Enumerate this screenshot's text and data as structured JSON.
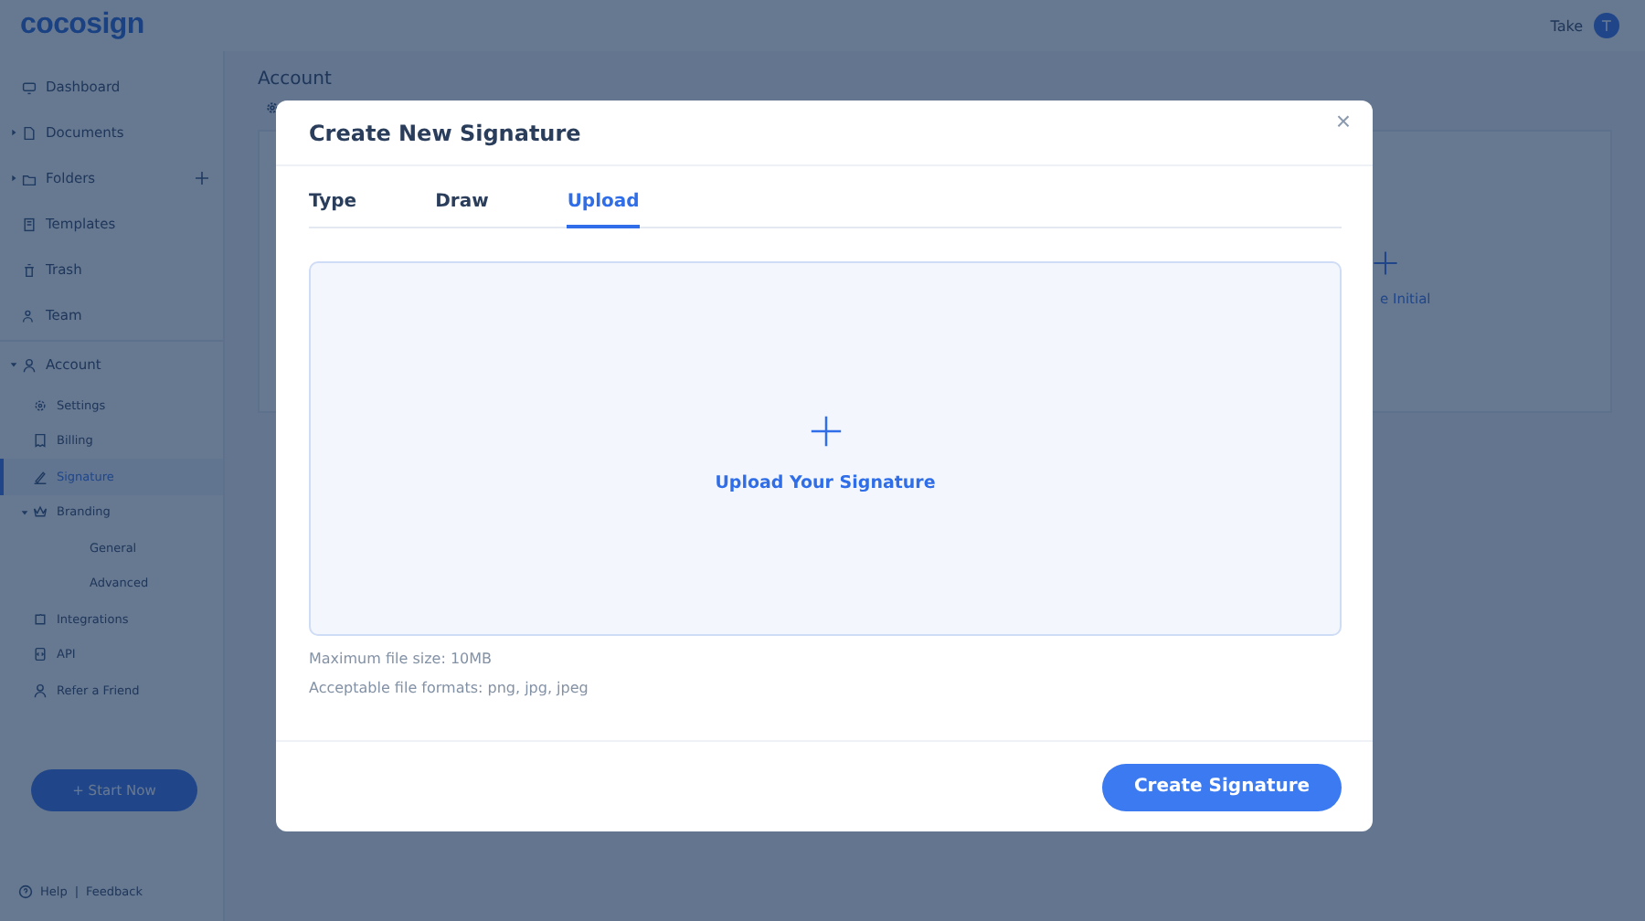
{
  "app": {
    "logo": "cocosign",
    "user": {
      "name": "Take",
      "initial": "T"
    }
  },
  "sidebar": {
    "items": [
      {
        "label": "Dashboard",
        "selected": false
      },
      {
        "label": "Documents",
        "selected": false,
        "expanded": false
      },
      {
        "label": "Folders",
        "selected": false,
        "expanded": false,
        "add_button": true
      },
      {
        "label": "Templates",
        "selected": false
      },
      {
        "label": "Trash",
        "selected": false
      },
      {
        "label": "Team",
        "selected": false
      },
      {
        "label": "Account",
        "selected": false,
        "expanded": true,
        "children": [
          {
            "label": "Settings",
            "selected": false
          },
          {
            "label": "Billing",
            "selected": false
          },
          {
            "label": "Signature",
            "selected": true
          },
          {
            "label": "Branding",
            "selected": false,
            "expanded": true,
            "children": [
              {
                "label": "General",
                "selected": false
              },
              {
                "label": "Advanced",
                "selected": false
              }
            ]
          },
          {
            "label": "Integrations",
            "selected": false
          },
          {
            "label": "API",
            "selected": false
          },
          {
            "label": "Refer a Friend",
            "selected": false
          }
        ]
      }
    ],
    "start_button": "+ Start Now",
    "footer": {
      "help": "Help",
      "separator": "|",
      "feedback": "Feedback"
    }
  },
  "page": {
    "title": "Account",
    "card_label": "e Initial"
  },
  "dialog": {
    "title": "Create New Signature",
    "close": "×",
    "tabs": [
      {
        "label": "Type",
        "selected": false
      },
      {
        "label": "Draw",
        "selected": false
      },
      {
        "label": "Upload",
        "selected": true
      }
    ],
    "dropzone": {
      "label": "Upload Your Signature"
    },
    "notes": [
      "Maximum file size: 10MB",
      "Acceptable file formats: png, jpg, jpeg"
    ],
    "primary_button": "Create Signature"
  }
}
